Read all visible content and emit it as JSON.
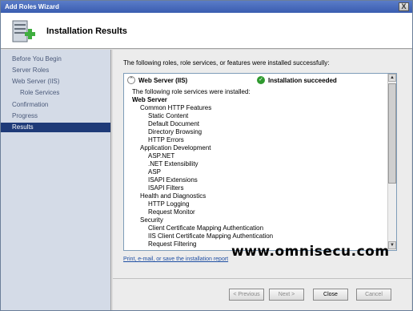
{
  "window": {
    "title": "Add Roles Wizard",
    "close_label": "X"
  },
  "header": {
    "title": "Installation Results"
  },
  "sidebar": {
    "items": [
      {
        "label": "Before You Begin"
      },
      {
        "label": "Server Roles"
      },
      {
        "label": "Web Server (IIS)"
      },
      {
        "label": "Role Services"
      },
      {
        "label": "Confirmation"
      },
      {
        "label": "Progress"
      },
      {
        "label": "Results"
      }
    ]
  },
  "content": {
    "intro": "The following roles, role services, or features were installed successfully:",
    "result": {
      "role": "Web Server (IIS)",
      "status": "Installation succeeded",
      "lines": [
        "The following role services were installed:",
        "Web Server",
        "Common HTTP Features",
        "Static Content",
        "Default Document",
        "Directory Browsing",
        "HTTP Errors",
        "Application Development",
        "ASP.NET",
        ".NET Extensibility",
        "ASP",
        "ISAPI Extensions",
        "ISAPI Filters",
        "Health and Diagnostics",
        "HTTP Logging",
        "Request Monitor",
        "Security",
        "Client Certificate Mapping Authentication",
        "IIS Client Certificate Mapping Authentication",
        "Request Filtering"
      ]
    },
    "print_link": "Print, e-mail, or save the installation report"
  },
  "watermark": "www.omnisecu.com",
  "buttons": {
    "previous": "< Previous",
    "next": "Next >",
    "close": "Close",
    "cancel": "Cancel"
  }
}
